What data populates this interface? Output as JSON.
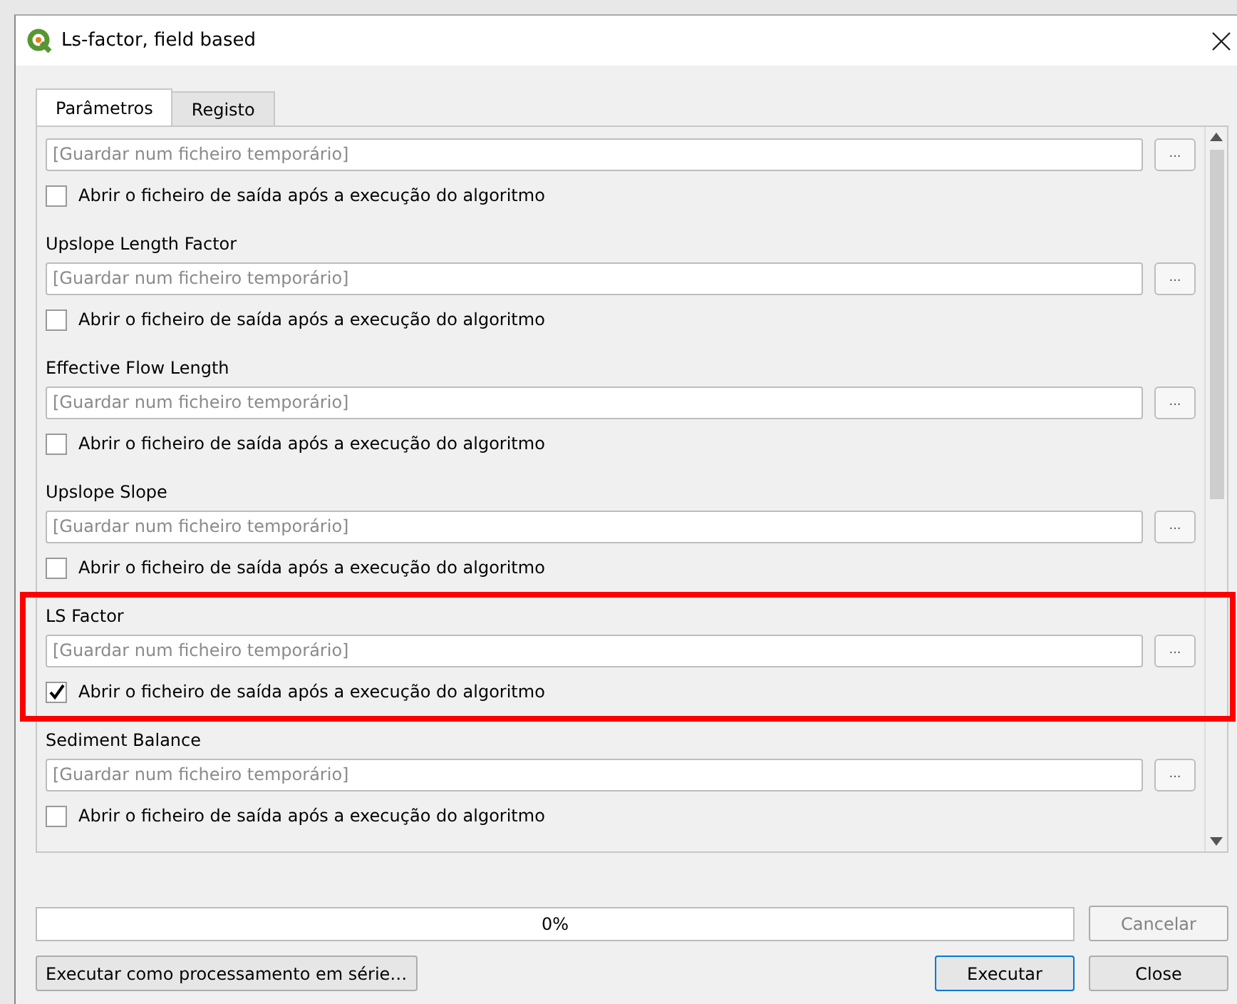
{
  "window": {
    "title": "Ls-factor, field based"
  },
  "tabs": [
    {
      "label": "Parâmetros",
      "selected": true
    },
    {
      "label": "Registo",
      "selected": false
    }
  ],
  "outputs": [
    {
      "placeholder": "[Guardar num ficheiro temporário]",
      "browse": "...",
      "open_label": "Abrir o ficheiro de saída após a execução do algoritmo",
      "checked": false,
      "highlighted": false
    },
    {
      "label": "Upslope Length Factor",
      "placeholder": "[Guardar num ficheiro temporário]",
      "browse": "...",
      "open_label": "Abrir o ficheiro de saída após a execução do algoritmo",
      "checked": false,
      "highlighted": false
    },
    {
      "label": "Effective Flow Length",
      "placeholder": "[Guardar num ficheiro temporário]",
      "browse": "...",
      "open_label": "Abrir o ficheiro de saída após a execução do algoritmo",
      "checked": false,
      "highlighted": false
    },
    {
      "label": "Upslope Slope",
      "placeholder": "[Guardar num ficheiro temporário]",
      "browse": "...",
      "open_label": "Abrir o ficheiro de saída após a execução do algoritmo",
      "checked": false,
      "highlighted": false
    },
    {
      "label": "LS Factor",
      "placeholder": "[Guardar num ficheiro temporário]",
      "browse": "...",
      "open_label": "Abrir o ficheiro de saída após a execução do algoritmo",
      "checked": true,
      "highlighted": true
    },
    {
      "label": "Sediment Balance",
      "placeholder": "[Guardar num ficheiro temporário]",
      "browse": "...",
      "open_label": "Abrir o ficheiro de saída após a execução do algoritmo",
      "checked": false,
      "highlighted": false
    }
  ],
  "progress": {
    "level": 0,
    "reading": "0%"
  },
  "buttons": [
    {
      "label": "Cancelar",
      "disabled": true,
      "default": false
    },
    {
      "label": "Executar como processamento em série…",
      "disabled": false,
      "default": false
    },
    {
      "label": "Executar",
      "disabled": false,
      "default": true
    },
    {
      "label": "Close",
      "disabled": false,
      "default": false
    }
  ]
}
